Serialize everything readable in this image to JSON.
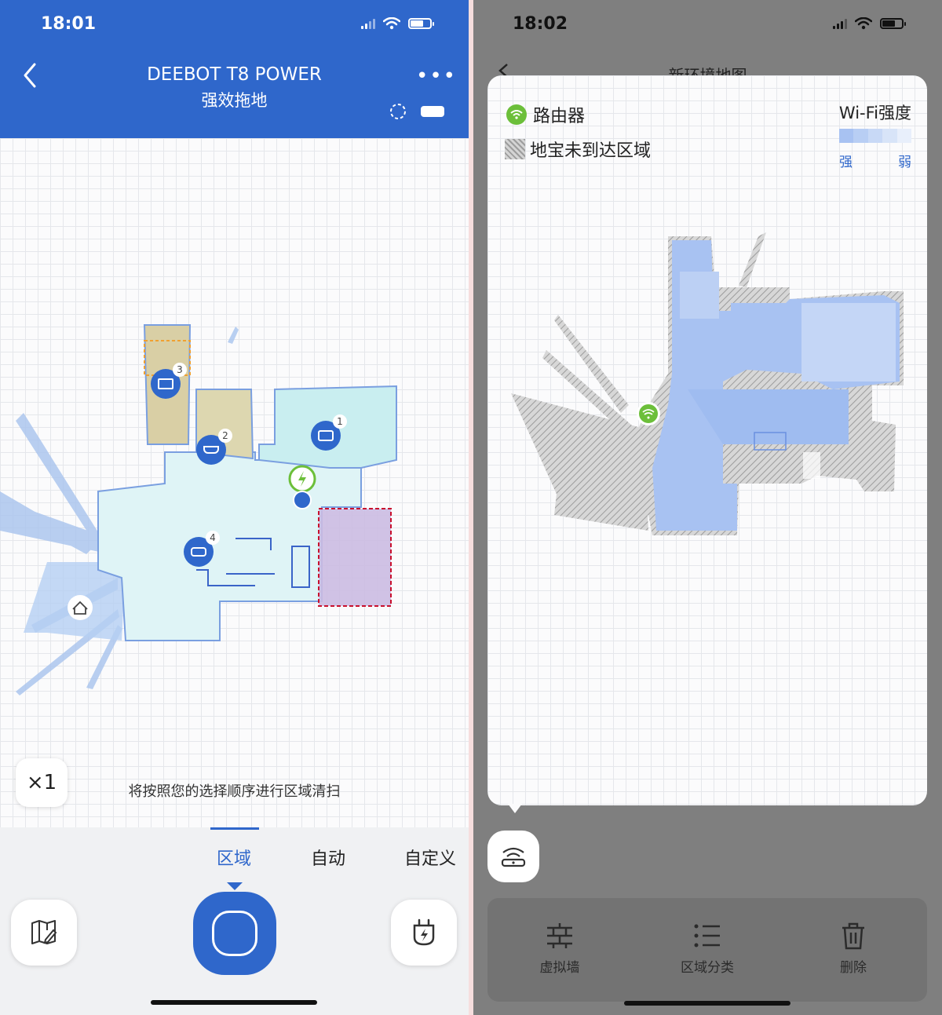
{
  "left": {
    "status": {
      "time": "18:01"
    },
    "header": {
      "title": "DEEBOT T8 POWER",
      "subtitle": "强效拖地"
    },
    "map": {
      "rooms": [
        {
          "number": "1",
          "icon": "bed-icon"
        },
        {
          "number": "2",
          "icon": "bathtub-icon"
        },
        {
          "number": "3",
          "icon": "book-icon"
        },
        {
          "number": "4",
          "icon": "sofa-icon"
        }
      ]
    },
    "speed_label": "×1",
    "hint": "将按照您的选择顺序进行区域清扫",
    "tabs": [
      {
        "label": "区域",
        "active": true
      },
      {
        "label": "自动",
        "active": false
      },
      {
        "label": "自定义",
        "active": false
      }
    ]
  },
  "right": {
    "status": {
      "time": "18:02"
    },
    "background_title": "新环境地图",
    "legend": {
      "router": "路由器",
      "unreached": "地宝未到达区域",
      "wifi_title": "Wi-Fi强度",
      "wifi_strong": "强",
      "wifi_weak": "弱"
    },
    "toolbar": [
      {
        "label": "虚拟墙",
        "icon": "virtual-wall-icon"
      },
      {
        "label": "区域分类",
        "icon": "list-icon"
      },
      {
        "label": "删除",
        "icon": "trash-icon"
      }
    ]
  },
  "colors": {
    "brand_blue": "#2f67cb",
    "router_green": "#6cbf3a",
    "room_cyan": "#d3f2f2",
    "room_tan": "#d8cfa6",
    "room_red_selection": "#c8102e",
    "coverage_blue": "#a9c2f3"
  }
}
